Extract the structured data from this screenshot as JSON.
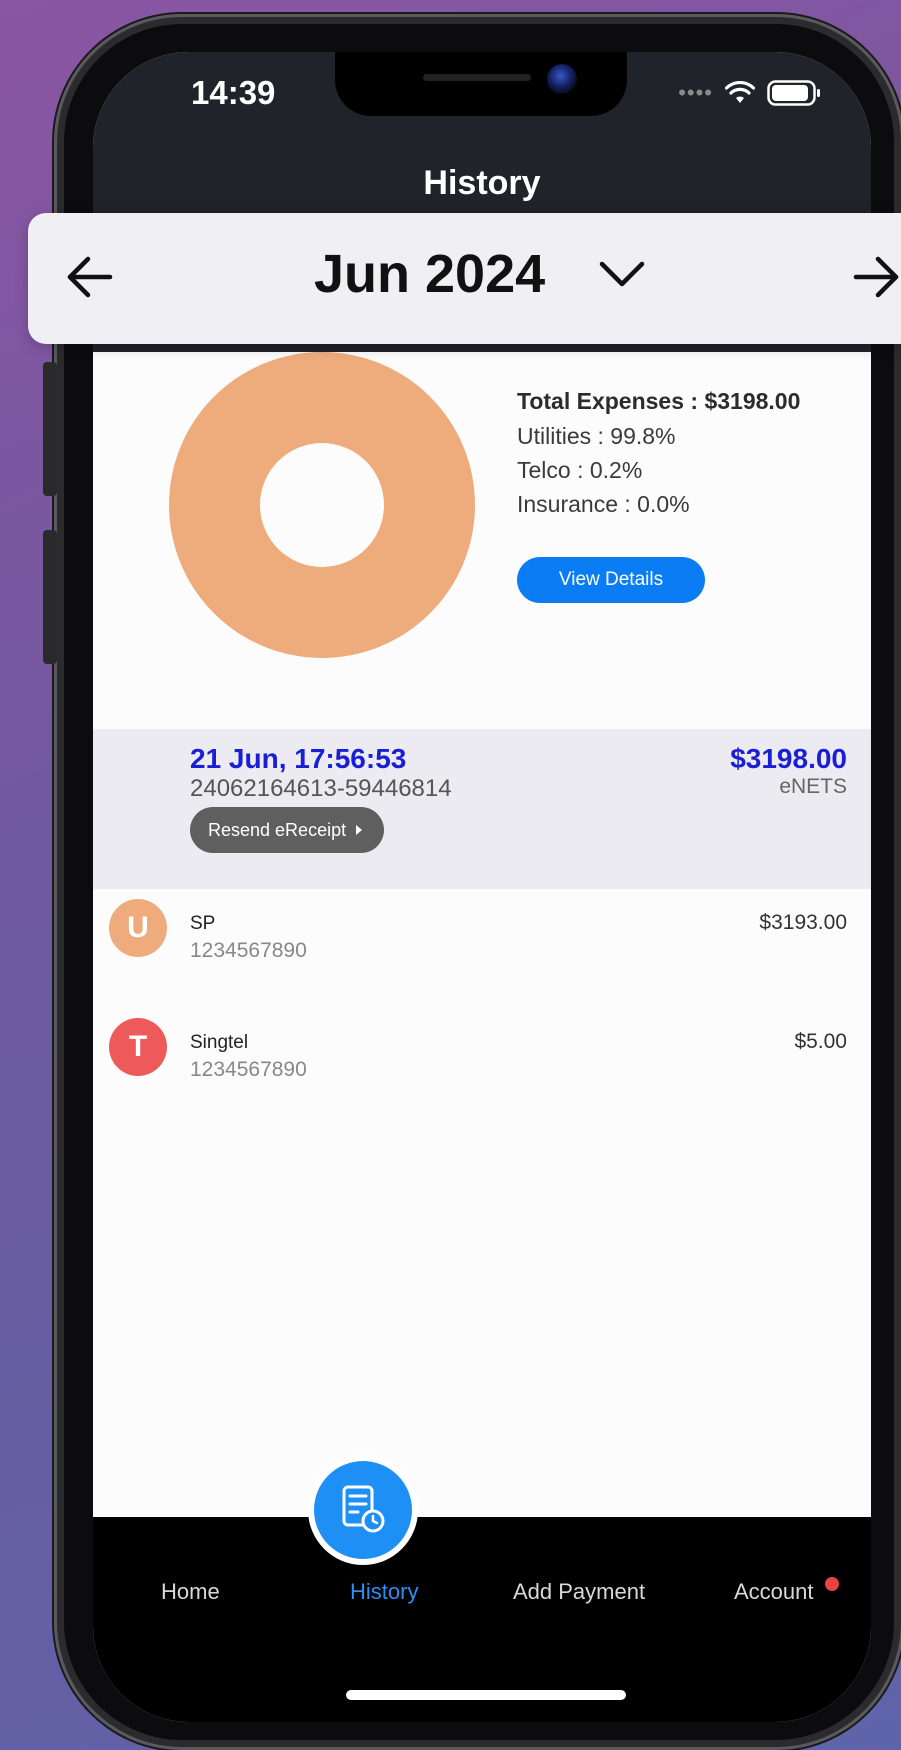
{
  "status_bar": {
    "time": "14:39"
  },
  "header": {
    "title": "History"
  },
  "month_selector": {
    "label": "Jun 2024"
  },
  "summary": {
    "total": "Total Expenses : $3198.00",
    "lines": [
      "Utilities : 99.8%",
      "Telco :  0.2%",
      "Insurance : 0.0%"
    ],
    "view_details": "View Details",
    "chart_color": "#eeac7d"
  },
  "transaction": {
    "date": "21 Jun, 17:56:53",
    "reference": "24062164613-59446814",
    "amount": "$3198.00",
    "method": "eNETS",
    "resend": "Resend eReceipt"
  },
  "items": [
    {
      "initial": "U",
      "name": "SP",
      "account": "1234567890",
      "amount": "$3193.00",
      "color": "#eeac7d"
    },
    {
      "initial": "T",
      "name": "Singtel",
      "account": "1234567890",
      "amount": "$5.00",
      "color": "#ee5a5a"
    }
  ],
  "nav": {
    "home": "Home",
    "history": "History",
    "add_payment": "Add Payment",
    "account": "Account"
  }
}
